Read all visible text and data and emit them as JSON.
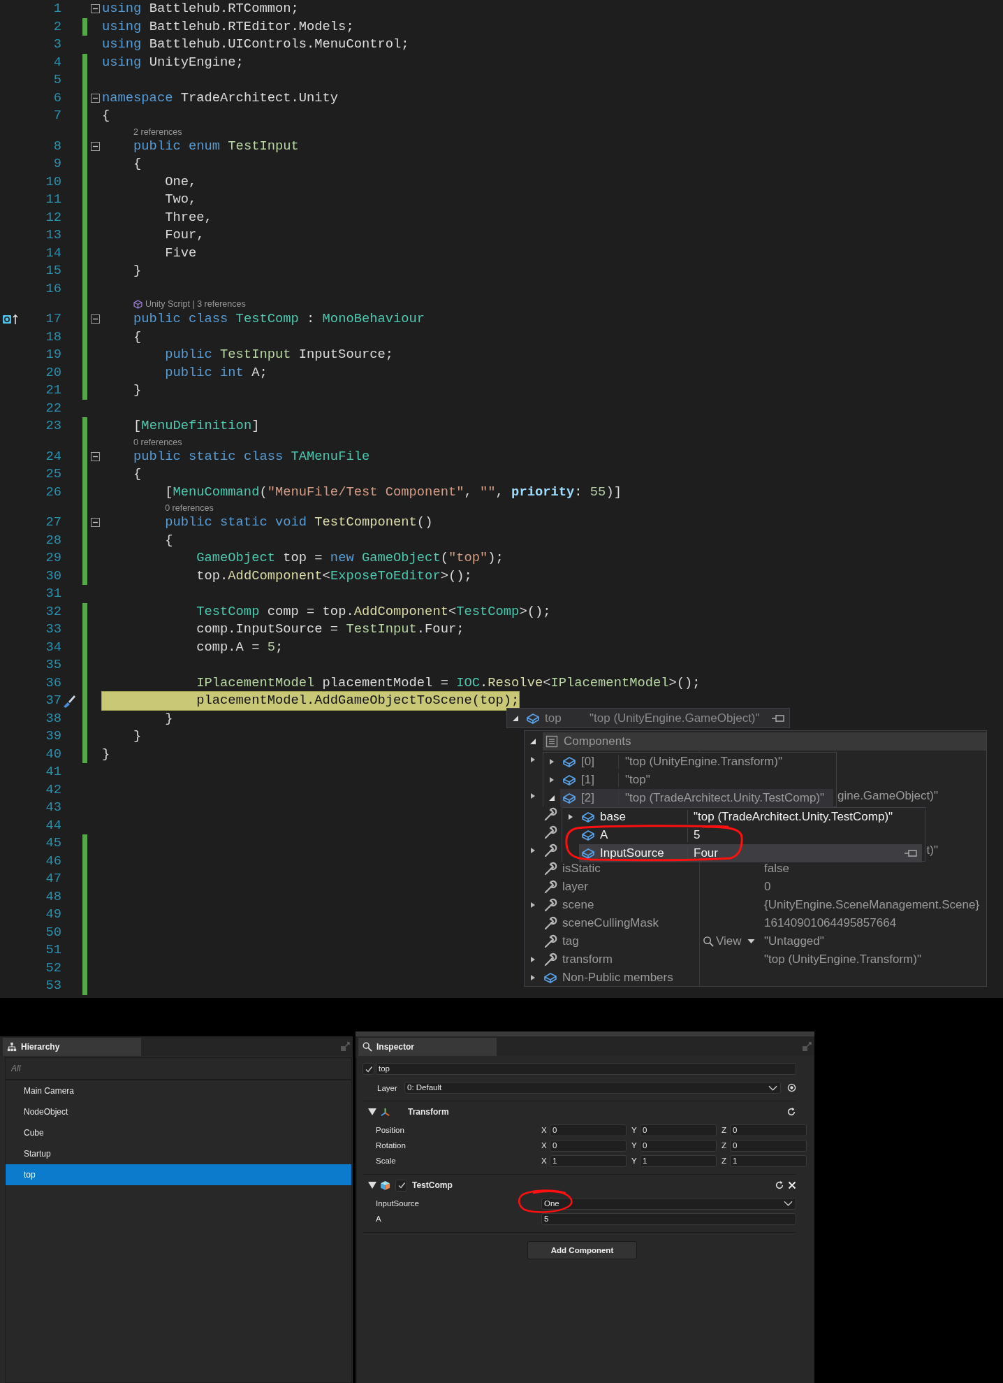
{
  "code": {
    "lines": [
      {
        "n": "1",
        "changed": false,
        "fold": true,
        "current": false,
        "tokens": [
          {
            "text": "using ",
            "kind": "keyword"
          },
          {
            "text": "Battlehub.RTCommon;",
            "kind": "plain"
          }
        ]
      },
      {
        "n": "2",
        "changed": true,
        "fold": false,
        "current": false,
        "tokens": [
          {
            "text": "using ",
            "kind": "keyword"
          },
          {
            "text": "Battlehub.RTEditor.Models;",
            "kind": "plain"
          }
        ]
      },
      {
        "n": "3",
        "changed": false,
        "fold": false,
        "current": false,
        "tokens": [
          {
            "text": "using ",
            "kind": "keyword"
          },
          {
            "text": "Battlehub.UIControls.MenuControl;",
            "kind": "plain"
          }
        ]
      },
      {
        "n": "4",
        "changed": true,
        "fold": false,
        "current": false,
        "tokens": [
          {
            "text": "using ",
            "kind": "keyword"
          },
          {
            "text": "UnityEngine;",
            "kind": "plain"
          }
        ]
      },
      {
        "n": "5",
        "changed": true,
        "fold": false,
        "current": false
      },
      {
        "n": "6",
        "changed": true,
        "fold": true,
        "current": false,
        "tokens": [
          {
            "text": "namespace ",
            "kind": "keyword"
          },
          {
            "text": "TradeArchitect.Unity",
            "kind": "plain"
          }
        ]
      },
      {
        "n": "7",
        "changed": true,
        "fold": false,
        "current": false,
        "tokens": [
          {
            "text": "{",
            "kind": "plain"
          }
        ]
      },
      {
        "n": "8",
        "changed": true,
        "fold": true,
        "current": false,
        "lens": "2 references",
        "lens_icon": false,
        "tokens": [
          {
            "text": "    public ",
            "kind": "keyword"
          },
          {
            "text": "enum ",
            "kind": "keyword"
          },
          {
            "text": "TestInput",
            "kind": "enum"
          }
        ]
      },
      {
        "n": "9",
        "changed": true,
        "fold": false,
        "current": false,
        "tokens": [
          {
            "text": "    {",
            "kind": "plain"
          }
        ]
      },
      {
        "n": "10",
        "changed": true,
        "fold": false,
        "current": false,
        "tokens": [
          {
            "text": "        One,",
            "kind": "plain"
          }
        ]
      },
      {
        "n": "11",
        "changed": true,
        "fold": false,
        "current": false,
        "tokens": [
          {
            "text": "        Two,",
            "kind": "plain"
          }
        ]
      },
      {
        "n": "12",
        "changed": true,
        "fold": false,
        "current": false,
        "tokens": [
          {
            "text": "        Three,",
            "kind": "plain"
          }
        ]
      },
      {
        "n": "13",
        "changed": true,
        "fold": false,
        "current": false,
        "tokens": [
          {
            "text": "        Four,",
            "kind": "plain"
          }
        ]
      },
      {
        "n": "14",
        "changed": true,
        "fold": false,
        "current": false,
        "tokens": [
          {
            "text": "        Five",
            "kind": "plain"
          }
        ]
      },
      {
        "n": "15",
        "changed": true,
        "fold": false,
        "current": false,
        "tokens": [
          {
            "text": "    }",
            "kind": "plain"
          }
        ]
      },
      {
        "n": "16",
        "changed": true,
        "fold": false,
        "current": false
      },
      {
        "n": "17",
        "changed": true,
        "fold": true,
        "current": false,
        "lens": "Unity Script | 3 references",
        "lens_icon": true,
        "tokens": [
          {
            "text": "    public ",
            "kind": "keyword"
          },
          {
            "text": "class ",
            "kind": "keyword"
          },
          {
            "text": "TestComp",
            "kind": "type"
          },
          {
            "text": " : ",
            "kind": "plain"
          },
          {
            "text": "MonoBehaviour",
            "kind": "type"
          }
        ]
      },
      {
        "n": "18",
        "changed": true,
        "fold": false,
        "current": false,
        "tokens": [
          {
            "text": "    {",
            "kind": "plain"
          }
        ]
      },
      {
        "n": "19",
        "changed": true,
        "fold": false,
        "current": false,
        "tokens": [
          {
            "text": "        public ",
            "kind": "keyword"
          },
          {
            "text": "TestInput",
            "kind": "enum"
          },
          {
            "text": " InputSource;",
            "kind": "plain"
          }
        ]
      },
      {
        "n": "20",
        "changed": true,
        "fold": false,
        "current": false,
        "tokens": [
          {
            "text": "        public ",
            "kind": "keyword"
          },
          {
            "text": "int",
            "kind": "keyword"
          },
          {
            "text": " A;",
            "kind": "plain"
          }
        ]
      },
      {
        "n": "21",
        "changed": true,
        "fold": false,
        "current": false,
        "tokens": [
          {
            "text": "    }",
            "kind": "plain"
          }
        ]
      },
      {
        "n": "22",
        "changed": false,
        "fold": false,
        "current": false
      },
      {
        "n": "23",
        "changed": true,
        "fold": false,
        "current": false,
        "tokens": [
          {
            "text": "    [",
            "kind": "plain"
          },
          {
            "text": "MenuDefinition",
            "kind": "type"
          },
          {
            "text": "]",
            "kind": "plain"
          }
        ]
      },
      {
        "n": "24",
        "changed": true,
        "fold": true,
        "current": false,
        "lens": "0 references",
        "lens_icon": false,
        "tokens": [
          {
            "text": "    public ",
            "kind": "keyword"
          },
          {
            "text": "static ",
            "kind": "keyword"
          },
          {
            "text": "class ",
            "kind": "keyword"
          },
          {
            "text": "TAMenuFile",
            "kind": "type"
          }
        ]
      },
      {
        "n": "25",
        "changed": true,
        "fold": false,
        "current": false,
        "tokens": [
          {
            "text": "    {",
            "kind": "plain"
          }
        ]
      },
      {
        "n": "26",
        "changed": true,
        "fold": false,
        "current": false,
        "tokens": [
          {
            "text": "        [",
            "kind": "plain"
          },
          {
            "text": "MenuCommand",
            "kind": "type"
          },
          {
            "text": "(",
            "kind": "plain"
          },
          {
            "text": "\"MenuFile/Test Component\"",
            "kind": "string"
          },
          {
            "text": ", ",
            "kind": "plain"
          },
          {
            "text": "\"\"",
            "kind": "string"
          },
          {
            "text": ", ",
            "kind": "plain"
          },
          {
            "text": "priority",
            "kind": "param"
          },
          {
            "text": ": ",
            "kind": "plain"
          },
          {
            "text": "55",
            "kind": "number"
          },
          {
            "text": ")]",
            "kind": "plain"
          }
        ]
      },
      {
        "n": "27",
        "changed": true,
        "fold": true,
        "current": false,
        "lens": "0 references",
        "lens_icon": false,
        "tokens": [
          {
            "text": "        public ",
            "kind": "keyword"
          },
          {
            "text": "static ",
            "kind": "keyword"
          },
          {
            "text": "void ",
            "kind": "keyword"
          },
          {
            "text": "TestComponent",
            "kind": "method"
          },
          {
            "text": "()",
            "kind": "plain"
          }
        ]
      },
      {
        "n": "28",
        "changed": true,
        "fold": false,
        "current": false,
        "tokens": [
          {
            "text": "        {",
            "kind": "plain"
          }
        ]
      },
      {
        "n": "29",
        "changed": true,
        "fold": false,
        "current": false,
        "tokens": [
          {
            "text": "            GameObject",
            "kind": "type"
          },
          {
            "text": " top = ",
            "kind": "plain"
          },
          {
            "text": "new ",
            "kind": "keyword"
          },
          {
            "text": "GameObject",
            "kind": "type"
          },
          {
            "text": "(",
            "kind": "plain"
          },
          {
            "text": "\"top\"",
            "kind": "string"
          },
          {
            "text": ");",
            "kind": "plain"
          }
        ]
      },
      {
        "n": "30",
        "changed": true,
        "fold": false,
        "current": false,
        "tokens": [
          {
            "text": "            top.",
            "kind": "plain"
          },
          {
            "text": "AddComponent",
            "kind": "method"
          },
          {
            "text": "<",
            "kind": "plain"
          },
          {
            "text": "ExposeToEditor",
            "kind": "type"
          },
          {
            "text": ">();",
            "kind": "plain"
          }
        ]
      },
      {
        "n": "31",
        "changed": false,
        "fold": false,
        "current": false
      },
      {
        "n": "32",
        "changed": true,
        "fold": false,
        "current": false,
        "tokens": [
          {
            "text": "            TestComp",
            "kind": "type"
          },
          {
            "text": " comp = top.",
            "kind": "plain"
          },
          {
            "text": "AddComponent",
            "kind": "method"
          },
          {
            "text": "<",
            "kind": "plain"
          },
          {
            "text": "TestComp",
            "kind": "type"
          },
          {
            "text": ">();",
            "kind": "plain"
          }
        ]
      },
      {
        "n": "33",
        "changed": true,
        "fold": false,
        "current": false,
        "tokens": [
          {
            "text": "            comp.InputSource = ",
            "kind": "plain"
          },
          {
            "text": "TestInput",
            "kind": "enum"
          },
          {
            "text": ".Four;",
            "kind": "plain"
          }
        ]
      },
      {
        "n": "34",
        "changed": true,
        "fold": false,
        "current": false,
        "tokens": [
          {
            "text": "            comp.A = ",
            "kind": "plain"
          },
          {
            "text": "5",
            "kind": "number"
          },
          {
            "text": ";",
            "kind": "plain"
          }
        ]
      },
      {
        "n": "35",
        "changed": true,
        "fold": false,
        "current": false
      },
      {
        "n": "36",
        "changed": true,
        "fold": false,
        "current": false,
        "tokens": [
          {
            "text": "            IPlacementModel",
            "kind": "enum"
          },
          {
            "text": " placementModel = ",
            "kind": "plain"
          },
          {
            "text": "IOC",
            "kind": "type"
          },
          {
            "text": ".",
            "kind": "plain"
          },
          {
            "text": "Resolve",
            "kind": "method"
          },
          {
            "text": "<",
            "kind": "plain"
          },
          {
            "text": "IPlacementModel",
            "kind": "enum"
          },
          {
            "text": ">();",
            "kind": "plain"
          }
        ]
      },
      {
        "n": "37",
        "changed": true,
        "fold": false,
        "current": true,
        "tokens": [
          {
            "text": "            placementModel.",
            "kind": "plain"
          },
          {
            "text": "AddGameObjectToScene",
            "kind": "method"
          },
          {
            "text": "(top);",
            "kind": "plain"
          }
        ]
      },
      {
        "n": "38",
        "changed": true,
        "fold": false,
        "current": false,
        "tokens": [
          {
            "text": "        }",
            "kind": "plain"
          }
        ]
      },
      {
        "n": "39",
        "changed": true,
        "fold": false,
        "current": false,
        "tokens": [
          {
            "text": "    }",
            "kind": "plain"
          }
        ]
      },
      {
        "n": "40",
        "changed": true,
        "fold": false,
        "current": false,
        "tokens": [
          {
            "text": "}",
            "kind": "plain"
          }
        ]
      },
      {
        "n": "41",
        "changed": false,
        "fold": false,
        "current": false
      },
      {
        "n": "42",
        "changed": false,
        "fold": false,
        "current": false
      },
      {
        "n": "43",
        "changed": false,
        "fold": false,
        "current": false
      },
      {
        "n": "44",
        "changed": false,
        "fold": false,
        "current": false
      },
      {
        "n": "45",
        "changed": true,
        "fold": false,
        "current": false
      },
      {
        "n": "46",
        "changed": true,
        "fold": false,
        "current": false
      },
      {
        "n": "47",
        "changed": true,
        "fold": false,
        "current": false
      },
      {
        "n": "48",
        "changed": true,
        "fold": false,
        "current": false
      },
      {
        "n": "49",
        "changed": true,
        "fold": false,
        "current": false
      },
      {
        "n": "50",
        "changed": true,
        "fold": false,
        "current": false
      },
      {
        "n": "51",
        "changed": true,
        "fold": false,
        "current": false
      },
      {
        "n": "52",
        "changed": true,
        "fold": false,
        "current": false
      },
      {
        "n": "53",
        "changed": true,
        "fold": false,
        "current": false
      }
    ]
  },
  "datatip": {
    "header": {
      "name": "top",
      "value": "\"top (UnityEngine.GameObject)\"",
      "expanded": true
    },
    "members": [
      {
        "kind": "group",
        "expanded": true,
        "name": "Components"
      },
      {
        "kind": "covered",
        "expanded": false
      },
      {
        "kind": "covered"
      },
      {
        "kind": "covered",
        "expanded": false,
        "value": "gine.GameObject)\"",
        "partial": true
      },
      {
        "kind": "property"
      },
      {
        "kind": "property"
      },
      {
        "kind": "property",
        "expanded": false,
        "value": "t)\"",
        "partial": true
      },
      {
        "kind": "property",
        "name": "isStatic",
        "value": "false",
        "partial": false
      },
      {
        "kind": "property",
        "name": "layer",
        "value": "0",
        "partial": false
      },
      {
        "kind": "property",
        "expanded": false,
        "name": "scene",
        "value": "{UnityEngine.SceneManagement.Scene}",
        "partial": false
      },
      {
        "kind": "property",
        "name": "sceneCullingMask",
        "value": "16140901064495857664",
        "partial": false
      },
      {
        "kind": "property",
        "name": "tag",
        "value": "\"Untagged\"",
        "view": "View",
        "partial": false
      },
      {
        "kind": "property",
        "expanded": false,
        "name": "transform",
        "value": "\"top (UnityEngine.Transform)\"",
        "partial": false
      },
      {
        "kind": "field",
        "expanded": false,
        "name": "Non-Public members"
      }
    ],
    "components": [
      {
        "name": "[0]",
        "value": "\"top (UnityEngine.Transform)\"",
        "expanded": false,
        "selected": false
      },
      {
        "name": "[1]",
        "value": "\"top\"",
        "expanded": false,
        "selected": false
      },
      {
        "name": "[2]",
        "value": "\"top (TradeArchitect.Unity.TestComp)\"",
        "expanded": true,
        "selected": true
      }
    ],
    "fields": [
      {
        "name": "base",
        "value": "\"top (TradeArchitect.Unity.TestComp)\"",
        "expanded": false,
        "selected": false
      },
      {
        "name": "A",
        "value": "5",
        "selected": false
      },
      {
        "name": "InputSource",
        "value": "Four",
        "selected": true
      }
    ]
  },
  "hierarchy": {
    "title": "Hierarchy",
    "filter_placeholder": "All",
    "items": [
      {
        "label": "Main Camera",
        "selected": false
      },
      {
        "label": "NodeObject",
        "selected": false
      },
      {
        "label": "Cube",
        "selected": false
      },
      {
        "label": "Startup",
        "selected": false
      },
      {
        "label": "top",
        "selected": true
      }
    ]
  },
  "inspector": {
    "title": "Inspector",
    "object": {
      "active": true,
      "name": "top"
    },
    "layer": {
      "label": "Layer",
      "value": "0: Default"
    },
    "components": [
      {
        "kind": "transform",
        "title": "Transform",
        "expanded": true,
        "rows": [
          {
            "label": "Position",
            "values": [
              {
                "axis": "X",
                "value": "0"
              },
              {
                "axis": "Y",
                "value": "0"
              },
              {
                "axis": "Z",
                "value": "0"
              }
            ]
          },
          {
            "label": "Rotation",
            "values": [
              {
                "axis": "X",
                "value": "0"
              },
              {
                "axis": "Y",
                "value": "0"
              },
              {
                "axis": "Z",
                "value": "0"
              }
            ]
          },
          {
            "label": "Scale",
            "values": [
              {
                "axis": "X",
                "value": "1"
              },
              {
                "axis": "Y",
                "value": "1"
              },
              {
                "axis": "Z",
                "value": "1"
              }
            ]
          }
        ]
      },
      {
        "kind": "script",
        "title": "TestComp",
        "expanded": true,
        "enabled": true,
        "fields": [
          {
            "kind": "dropdown",
            "label": "InputSource",
            "value": "One"
          },
          {
            "kind": "number",
            "label": "A",
            "value": "5"
          }
        ]
      }
    ],
    "add_button": "Add Component"
  }
}
